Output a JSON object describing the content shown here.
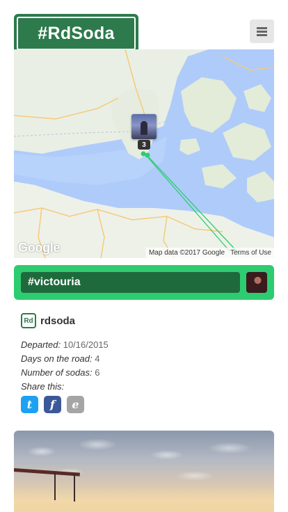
{
  "header": {
    "logo_text": "#RdSoda",
    "menu_icon": "hamburger-menu-icon"
  },
  "map": {
    "marker_count": "3",
    "google_label": "Google",
    "attribution": "Map data ©2017 Google",
    "terms": "Terms of Use"
  },
  "trip": {
    "hashtag": "#victouria",
    "username": "rdsoda",
    "badge_text": "Rd"
  },
  "details": {
    "departed_label": "Departed:",
    "departed_value": "10/16/2015",
    "days_label": "Days on the road:",
    "days_value": "4",
    "sodas_label": "Number of sodas:",
    "sodas_value": "6",
    "share_label": "Share this:"
  },
  "share": {
    "twitter_glyph": "t",
    "facebook_glyph": "f",
    "email_glyph": "e"
  },
  "colors": {
    "brand_green": "#2d7a4c",
    "accent_green": "#2ecc71",
    "twitter": "#1da1f2",
    "facebook": "#3b5998"
  }
}
